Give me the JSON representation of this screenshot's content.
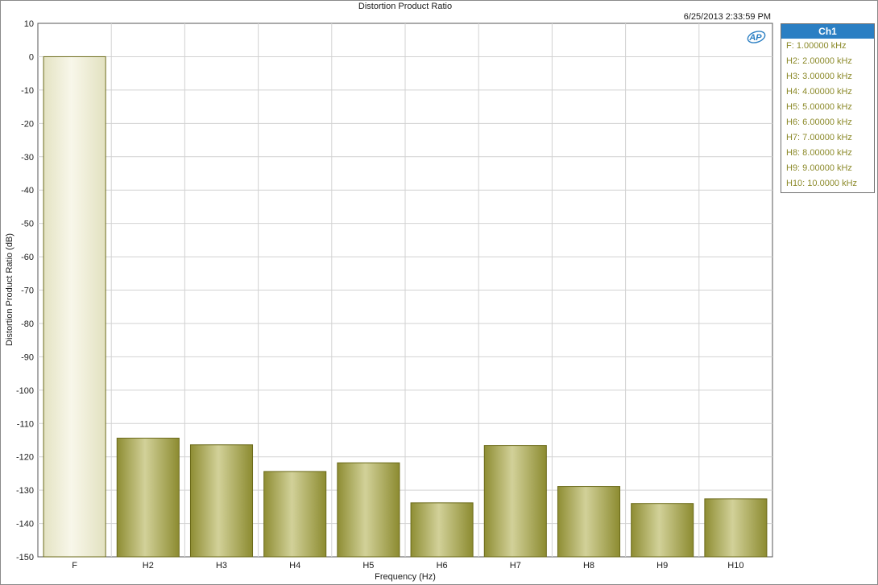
{
  "chart_data": {
    "type": "bar",
    "title": "Distortion Product Ratio",
    "timestamp": "6/25/2013 2:33:59 PM",
    "xlabel": "Frequency (Hz)",
    "ylabel": "Distortion Product Ratio (dB)",
    "ylim": [
      -150,
      10
    ],
    "yticks": [
      "10",
      "0",
      "-10",
      "-20",
      "-30",
      "-40",
      "-50",
      "-60",
      "-70",
      "-80",
      "-90",
      "-100",
      "-110",
      "-120",
      "-130",
      "-140",
      "-150"
    ],
    "grid": true,
    "categories": [
      "F",
      "H2",
      "H3",
      "H4",
      "H5",
      "H6",
      "H7",
      "H8",
      "H9",
      "H10"
    ],
    "values": [
      0,
      -114.4,
      -116.4,
      -124.4,
      -121.8,
      -133.8,
      -116.6,
      -128.9,
      -134.0,
      -132.6
    ],
    "bar_colors": {
      "fundamental_fill": "#f1f0dc",
      "harmonic_fill": "#a8a752",
      "edge": "#6b6a1a"
    },
    "legend": {
      "header": "Ch1",
      "items": [
        "F: 1.00000 kHz",
        "H2: 2.00000 kHz",
        "H3: 3.00000 kHz",
        "H4: 4.00000 kHz",
        "H5: 5.00000 kHz",
        "H6: 6.00000 kHz",
        "H7: 7.00000 kHz",
        "H8: 8.00000 kHz",
        "H9: 9.00000 kHz",
        "H10: 10.0000 kHz"
      ],
      "header_color": "#2b7fc3",
      "item_color": "#8c8a2a",
      "placement": "right"
    },
    "logo": "AP"
  }
}
